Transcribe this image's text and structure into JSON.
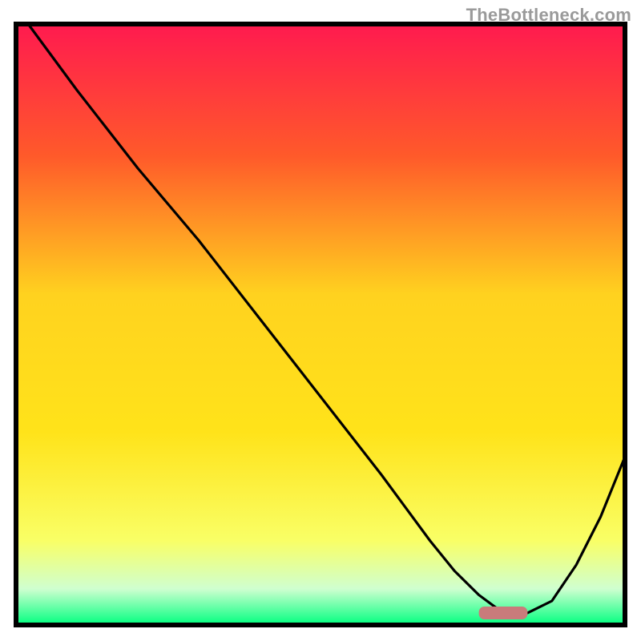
{
  "watermark": "TheBottleneck.com",
  "chart_data": {
    "type": "line",
    "title": "",
    "xlabel": "",
    "ylabel": "",
    "xlim": [
      0,
      100
    ],
    "ylim": [
      0,
      100
    ],
    "series": [
      {
        "name": "curve",
        "x": [
          2,
          10,
          20,
          25,
          30,
          40,
          50,
          60,
          68,
          72,
          76,
          80,
          84,
          88,
          92,
          96,
          100
        ],
        "y": [
          100,
          89,
          76,
          70,
          64,
          51,
          38,
          25,
          14,
          9,
          5,
          2,
          2,
          4,
          10,
          18,
          28
        ]
      }
    ],
    "marker": {
      "name": "optimal-band",
      "x_center": 80,
      "width": 8,
      "y": 2,
      "color": "#c97b7b"
    },
    "palette": {
      "curve": "#000000",
      "border": "#000000",
      "background_top": "#ff1a4f",
      "background_upper": "#ff7a1f",
      "background_mid": "#ffd21f",
      "background_lower": "#f9ff66",
      "background_bottom_fade": "#cfffd0",
      "background_bottom": "#00ff7f"
    }
  }
}
